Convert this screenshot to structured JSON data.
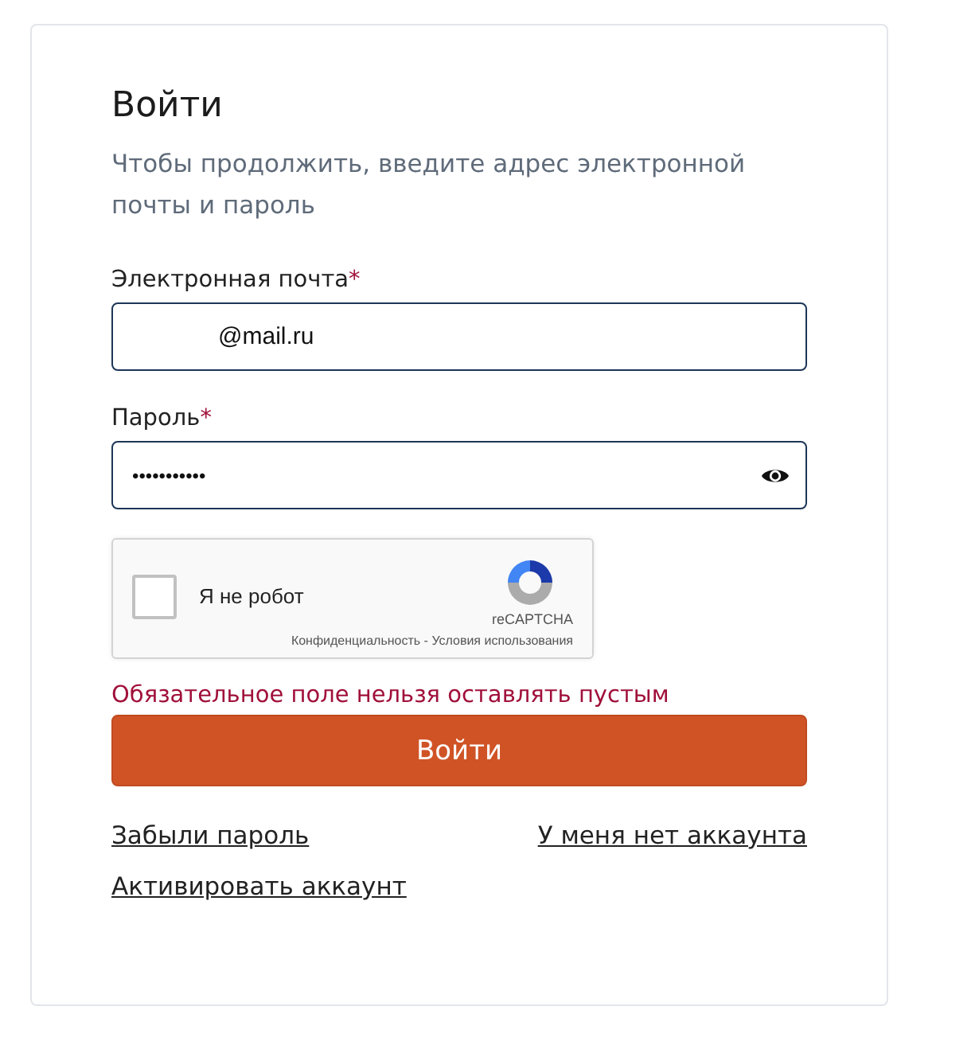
{
  "title": "Войти",
  "subtitle": "Чтобы продолжить, введите адрес электронной почты и пароль",
  "fields": [
    {
      "kind": "email",
      "label": "Электронная почта",
      "required_mark": "*",
      "value": "@mail.ru"
    },
    {
      "kind": "password",
      "label": "Пароль",
      "required_mark": "*",
      "value": "•••••••••••"
    }
  ],
  "captcha": {
    "checked": false,
    "label": "Я не робот",
    "brand": "reCAPTCHA",
    "footer": "Конфиденциальность - Условия использования"
  },
  "error": "Обязательное поле нельзя оставлять пустым",
  "submit_button": "Войти",
  "links": [
    {
      "label": "Забыли пароль"
    },
    {
      "label": "У меня нет аккаунта"
    },
    {
      "label": "Активировать аккаунт"
    }
  ]
}
